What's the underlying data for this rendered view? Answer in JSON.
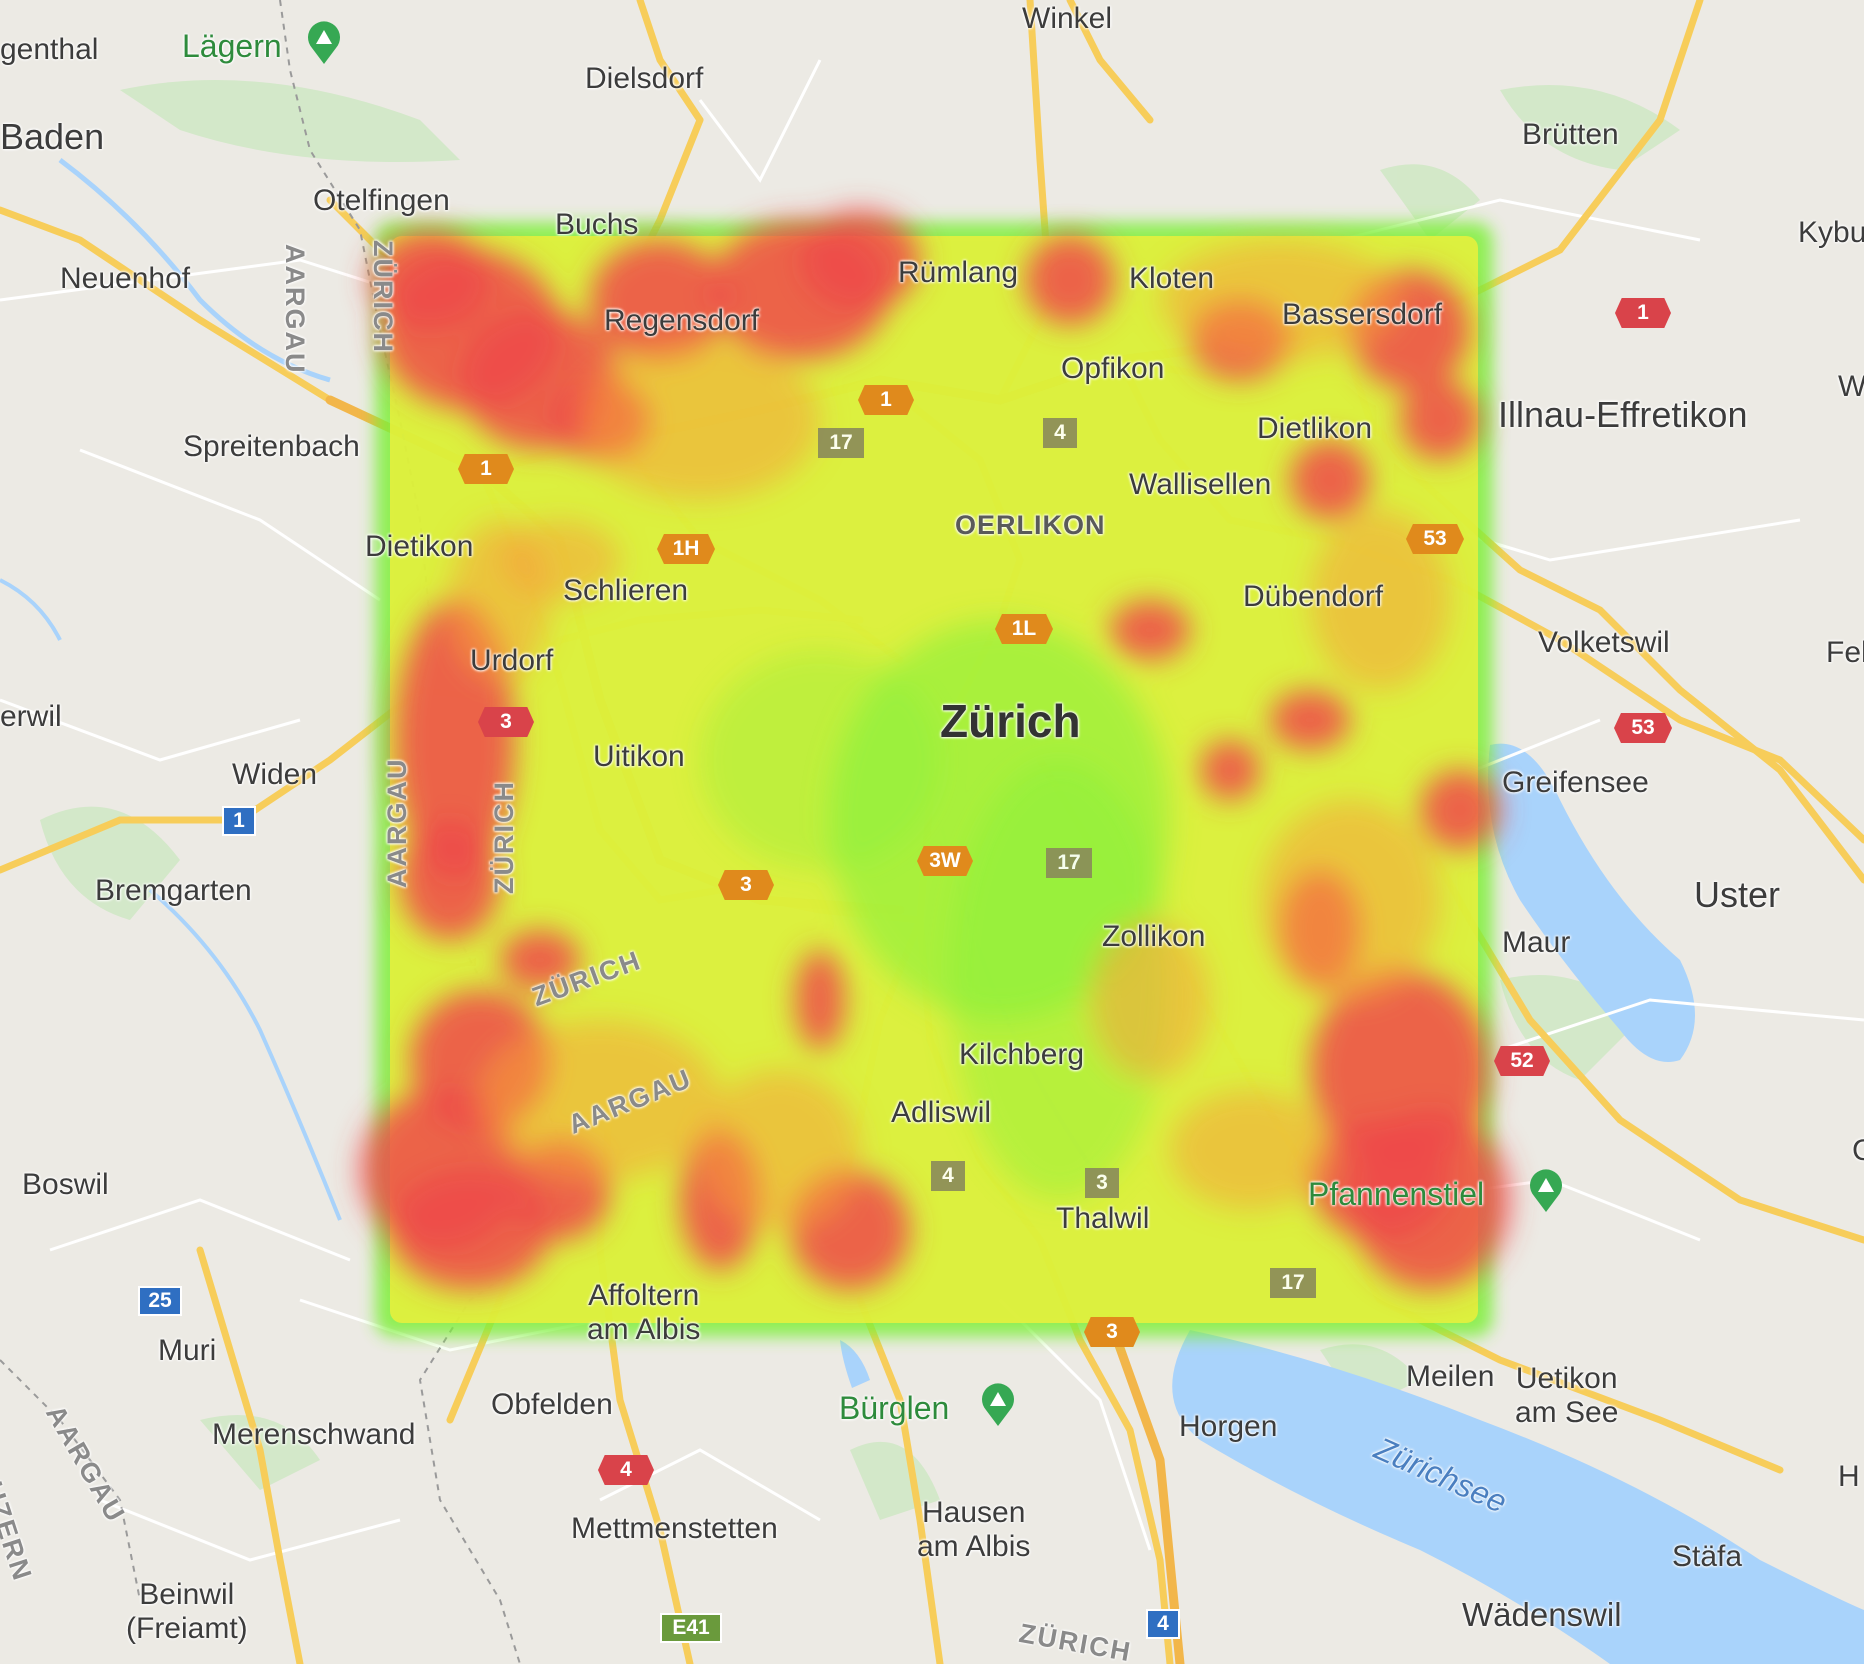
{
  "map": {
    "colors": {
      "land": "#eceae4",
      "forest": "#cfe8c4",
      "water": "#a9d3fb",
      "road": "#f7cd5a",
      "heat_low": "#7ff03a",
      "heat_mid": "#f2ef3a",
      "heat_high": "#ef4a4a"
    },
    "labels": {
      "city": "Zürich",
      "baden": "Baden",
      "uster": "Uster",
      "illnau": "Illnau-Effretikon",
      "laegern": "Lägern",
      "buerglen": "Bürglen",
      "pfannenstiel": "Pfannenstiel",
      "zuerichsee": "Zürichsee",
      "oerlikon": "OERLIKON",
      "genthal": "genthal",
      "dielsdorf": "Dielsdorf",
      "winkel": "Winkel",
      "bruetten": "Brütten",
      "kybu": "Kybu",
      "w_edge": "W",
      "otelfingen": "Otelfingen",
      "buchs": "Buchs",
      "neuenhof": "Neuenhof",
      "ruemlang": "Rümlang",
      "kloten": "Kloten",
      "regensdorf": "Regensdorf",
      "bassersdorf": "Bassersdorf",
      "opfikon": "Opfikon",
      "spreitenbach": "Spreitenbach",
      "dietlikon": "Dietlikon",
      "wallisellen": "Wallisellen",
      "dietikon": "Dietikon",
      "schlieren": "Schlieren",
      "duebendorf": "Dübendorf",
      "volketswil": "Volketswil",
      "feh": "Feh",
      "urdorf": "Urdorf",
      "erwil": "erwil",
      "uitikon": "Uitikon",
      "widen": "Widen",
      "greifensee": "Greifensee",
      "bremgarten": "Bremgarten",
      "zollikon": "Zollikon",
      "maur": "Maur",
      "kilchberg": "Kilchberg",
      "adliswil": "Adliswil",
      "boswil": "Boswil",
      "c_edge": "C",
      "thalwil": "Thalwil",
      "affoltern_1": "Affoltern",
      "affoltern_2": "am Albis",
      "muri": "Muri",
      "obfelden": "Obfelden",
      "meilen": "Meilen",
      "uetikon_1": "Uetikon",
      "uetikon_2": "am See",
      "horgen": "Horgen",
      "merenschwand": "Merenschwand",
      "h_edge": "H",
      "mettmenstetten": "Mettmenstetten",
      "hausen_1": "Hausen",
      "hausen_2": "am Albis",
      "staefa": "Stäfa",
      "beinwil_1": "Beinwil",
      "beinwil_2": "(Freiamt)",
      "waedenswil": "Wädenswil",
      "zuerich_canton_1": "ZÜRICH",
      "zuerich_canton_2": "ZÜRICH",
      "zuerich_canton_3": "ZÜRICH",
      "zuerich_canton_4": "ZÜRICH",
      "aargau_1": "AARGAU",
      "aargau_2": "AARGAU",
      "aargau_3": "AARGAU",
      "aargau_4": "AARGAU",
      "luzern": "UZERN"
    },
    "shields": {
      "a1_east": "1",
      "a1_mid": "1",
      "a1_west": "1",
      "r17_north": "17",
      "r4_north": "4",
      "a1h": "1H",
      "a53_north": "53",
      "a1l": "1L",
      "a53_east": "53",
      "a3_west": "3",
      "r1_blue": "1",
      "a3w": "3W",
      "r17_center": "17",
      "a3_center": "3",
      "a52": "52",
      "r4_south": "4",
      "r3_thalwil": "3",
      "r17_south": "17",
      "a3_south": "3",
      "r25": "25",
      "a4": "4",
      "e41": "E41",
      "r4_blue": "4"
    }
  }
}
